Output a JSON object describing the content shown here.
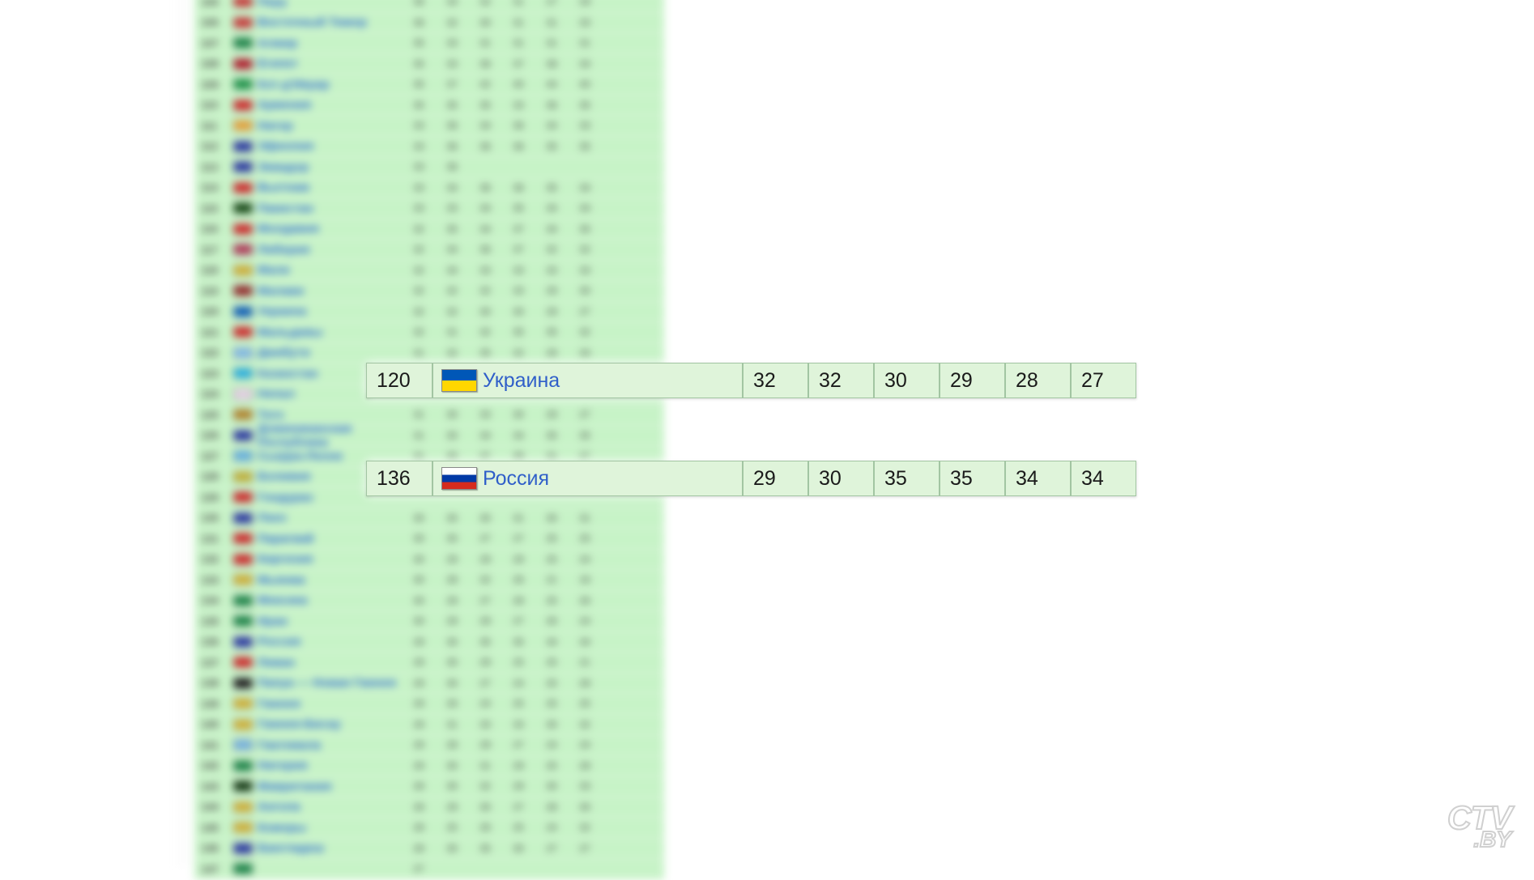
{
  "watermark": {
    "line1": "CTV",
    "line2": ".BY"
  },
  "highlighted_rows": [
    {
      "rank": "120",
      "flag": "ukraine",
      "country": "Украина",
      "scores": [
        "32",
        "32",
        "30",
        "29",
        "28",
        "27"
      ]
    },
    {
      "rank": "136",
      "flag": "russia",
      "country": "Россия",
      "scores": [
        "29",
        "30",
        "35",
        "35",
        "34",
        "34"
      ]
    }
  ],
  "blurred_table_rows": [
    {
      "rank": "105",
      "flag": "#c83030",
      "country": "Перу",
      "nums": [
        "36",
        "34",
        "32",
        "31",
        "27",
        "29"
      ]
    },
    {
      "rank": "106",
      "flag": "#c83030",
      "country": "Восточный Тимор",
      "nums": [
        "36",
        "32",
        "30",
        "31",
        "31",
        "33"
      ]
    },
    {
      "rank": "107",
      "flag": "#108040",
      "country": "Алжир",
      "nums": [
        "35",
        "33",
        "31",
        "31",
        "31",
        "31"
      ]
    },
    {
      "rank": "108",
      "flag": "#b01020",
      "country": "Египет",
      "nums": [
        "35",
        "33",
        "36",
        "37",
        "38",
        "34"
      ]
    },
    {
      "rank": "109",
      "flag": "#109040",
      "country": "Кот-д'Ивуар",
      "nums": [
        "35",
        "37",
        "42",
        "40",
        "44",
        "40"
      ]
    },
    {
      "rank": "110",
      "flag": "#d02020",
      "country": "Армения",
      "nums": [
        "35",
        "35",
        "35",
        "33",
        "36",
        "35"
      ]
    },
    {
      "rank": "111",
      "flag": "#e8a030",
      "country": "Нигер",
      "nums": [
        "33",
        "36",
        "34",
        "36",
        "34",
        "33"
      ]
    },
    {
      "rank": "112",
      "flag": "#2030a0",
      "country": "Эфиопия",
      "nums": [
        "33",
        "36",
        "36",
        "36",
        "35",
        "35"
      ]
    },
    {
      "rank": "113",
      "flag": "#2030a0",
      "country": "Эквадор",
      "nums": [
        "33",
        "36",
        "",
        "",
        "",
        ""
      ]
    },
    {
      "rank": "114",
      "flag": "#d02020",
      "country": "Вьетнам",
      "nums": [
        "33",
        "34",
        "36",
        "36",
        "35",
        "34"
      ]
    },
    {
      "rank": "115",
      "flag": "#084008",
      "country": "Пакистан",
      "nums": [
        "33",
        "33",
        "34",
        "35",
        "34",
        "34"
      ]
    },
    {
      "rank": "116",
      "flag": "#d02020",
      "country": "Молдавия",
      "nums": [
        "32",
        "35",
        "34",
        "37",
        "34",
        "35"
      ]
    },
    {
      "rank": "117",
      "flag": "#b03050",
      "country": "Либерия",
      "nums": [
        "32",
        "34",
        "36",
        "37",
        "32",
        "32"
      ]
    },
    {
      "rank": "118",
      "flag": "#d0b030",
      "country": "Мали",
      "nums": [
        "32",
        "34",
        "33",
        "33",
        "33",
        "33"
      ]
    },
    {
      "rank": "119",
      "flag": "#902020",
      "country": "Малави",
      "nums": [
        "32",
        "32",
        "32",
        "33",
        "29",
        "30"
      ]
    },
    {
      "rank": "120",
      "flag": "#0057b7",
      "country": "Украина",
      "nums": [
        "32",
        "32",
        "30",
        "30",
        "29",
        "27"
      ]
    },
    {
      "rank": "121",
      "flag": "#d02020",
      "country": "Мальдивы",
      "nums": [
        "32",
        "31",
        "32",
        "35",
        "35",
        "32"
      ]
    },
    {
      "rank": "122",
      "flag": "#7db8e8",
      "country": "Джибути",
      "nums": [
        "31",
        "32",
        "35",
        "32",
        "28",
        "34"
      ]
    },
    {
      "rank": "123",
      "flag": "#20b0e0",
      "country": "Казахстан",
      "nums": [
        "",
        "",
        "",
        "",
        "",
        ""
      ]
    },
    {
      "rank": "124",
      "flag": "#e8d0e8",
      "country": "Непал",
      "nums": [
        "",
        "",
        "",
        "",
        "",
        ""
      ]
    },
    {
      "rank": "125",
      "flag": "#b08020",
      "country": "Того",
      "nums": [
        "31",
        "30",
        "33",
        "30",
        "29",
        "27"
      ]
    },
    {
      "rank": "126",
      "flag": "#2030a0",
      "country": "Доминиканская Республика",
      "nums": [
        "31",
        "30",
        "34",
        "34",
        "35",
        "35"
      ]
    },
    {
      "rank": "127",
      "flag": "#60b0e0",
      "country": "Сьерра-Леоне",
      "nums": [
        "31",
        "30",
        "37",
        "39",
        "31",
        "27"
      ]
    },
    {
      "rank": "128",
      "flag": "#c0b030",
      "country": "Боливия",
      "nums": [
        "",
        "",
        "",
        "",
        "",
        ""
      ]
    },
    {
      "rank": "129",
      "flag": "#d02020",
      "country": "Гондурас",
      "nums": [
        "",
        "",
        "",
        "",
        "",
        ""
      ]
    },
    {
      "rank": "130",
      "flag": "#2030a0",
      "country": "Лаос",
      "nums": [
        "30",
        "30",
        "30",
        "31",
        "30",
        "31"
      ]
    },
    {
      "rank": "131",
      "flag": "#d02020",
      "country": "Парагвай",
      "nums": [
        "30",
        "30",
        "27",
        "27",
        "25",
        "25"
      ]
    },
    {
      "rank": "132",
      "flag": "#d02020",
      "country": "Киргизия",
      "nums": [
        "30",
        "29",
        "29",
        "29",
        "25",
        "24"
      ]
    },
    {
      "rank": "133",
      "flag": "#d0b030",
      "country": "Мьянма",
      "nums": [
        "30",
        "28",
        "32",
        "26",
        "21",
        "16"
      ]
    },
    {
      "rank": "134",
      "flag": "#108040",
      "country": "Мексика",
      "nums": [
        "30",
        "29",
        "27",
        "28",
        "25",
        "26"
      ]
    },
    {
      "rank": "135",
      "flag": "#108040",
      "country": "Иран",
      "nums": [
        "30",
        "29",
        "29",
        "27",
        "26",
        "24"
      ]
    },
    {
      "rank": "136",
      "flag": "#2030a0",
      "country": "Россия",
      "nums": [
        "29",
        "30",
        "35",
        "35",
        "34",
        "34"
      ]
    },
    {
      "rank": "137",
      "flag": "#d02020",
      "country": "Ливан",
      "nums": [
        "29",
        "30",
        "29",
        "25",
        "25",
        "21"
      ]
    },
    {
      "rank": "138",
      "flag": "#101010",
      "country": "Папуа — Новая Гвинея",
      "nums": [
        "29",
        "30",
        "27",
        "24",
        "25",
        "28"
      ]
    },
    {
      "rank": "139",
      "flag": "#d0b030",
      "country": "Гвинея",
      "nums": [
        "29",
        "26",
        "24",
        "25",
        "25",
        "25"
      ]
    },
    {
      "rank": "140",
      "flag": "#d0b030",
      "country": "Гвинея-Бисау",
      "nums": [
        "29",
        "31",
        "33",
        "33",
        "30",
        "32"
      ]
    },
    {
      "rank": "141",
      "flag": "#70b0e0",
      "country": "Гватемала",
      "nums": [
        "29",
        "28",
        "29",
        "27",
        "24",
        "24"
      ]
    },
    {
      "rank": "142",
      "flag": "#108040",
      "country": "Нигерия",
      "nums": [
        "29",
        "30",
        "31",
        "29",
        "25",
        "28"
      ]
    },
    {
      "rank": "143",
      "flag": "#083008",
      "country": "Мавритания",
      "nums": [
        "28",
        "30",
        "32",
        "29",
        "30",
        "33"
      ]
    },
    {
      "rank": "144",
      "flag": "#d0b030",
      "country": "Ангола",
      "nums": [
        "28",
        "29",
        "30",
        "27",
        "28",
        "30"
      ]
    },
    {
      "rank": "145",
      "flag": "#d0b030",
      "country": "Коморы",
      "nums": [
        "28",
        "25",
        "26",
        "25",
        "24",
        "32"
      ]
    },
    {
      "rank": "146",
      "flag": "#2030a0",
      "country": "Бангладеш",
      "nums": [
        "28",
        "30",
        "35",
        "30",
        "27",
        "27"
      ]
    },
    {
      "rank": "147",
      "flag": "#108040",
      "country": "",
      "nums": [
        "27",
        "",
        "",
        "",
        "",
        ""
      ]
    }
  ]
}
